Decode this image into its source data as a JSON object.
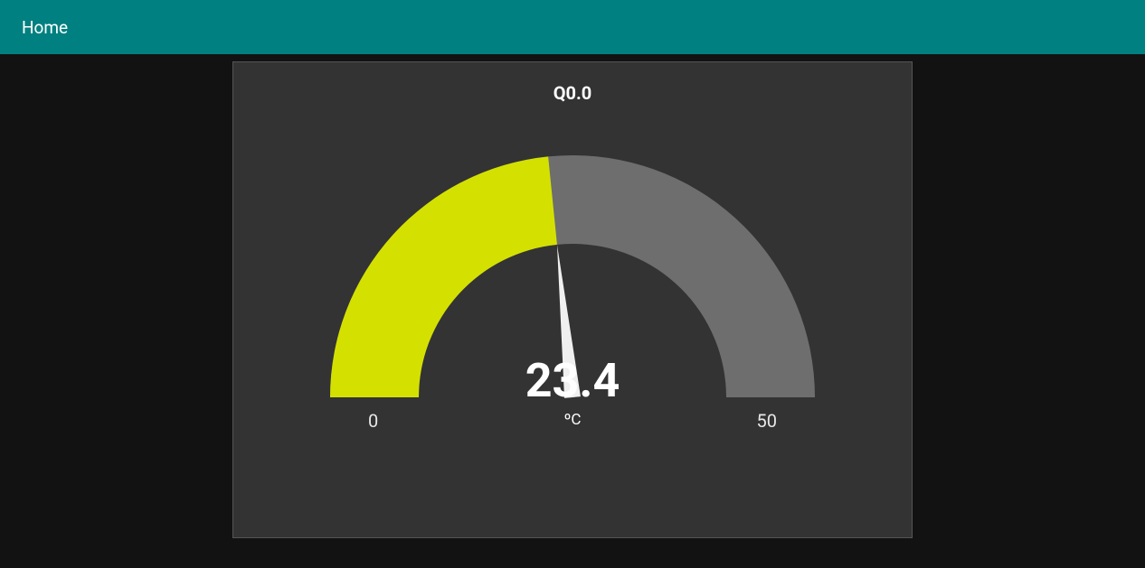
{
  "navbar": {
    "home_label": "Home"
  },
  "gauge": {
    "title": "Q0.0",
    "value_display": "23.4",
    "value_numeric": 23.4,
    "unit": "ºC",
    "min": 0,
    "max": 50,
    "min_label": "0",
    "max_label": "50",
    "fill_color": "#d4e100",
    "track_color": "#6e6e6e",
    "needle_color": "#f0f0f0"
  },
  "chart_data": {
    "type": "gauge",
    "title": "Q0.0",
    "value": 23.4,
    "min": 0,
    "max": 50,
    "unit": "ºC",
    "xlabel": "",
    "ylabel": "",
    "ylim": [
      0,
      50
    ]
  }
}
